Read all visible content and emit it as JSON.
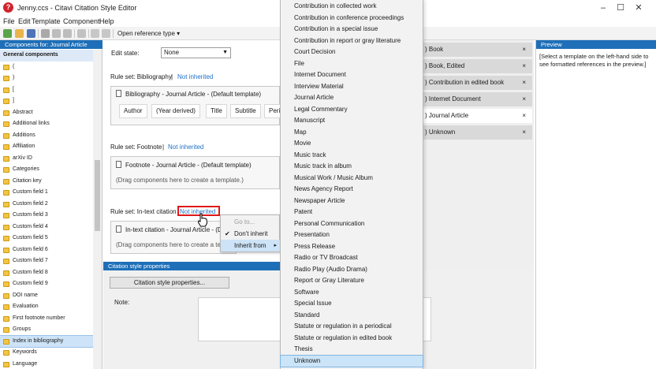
{
  "window": {
    "title": "Jenny.ccs - Citavi Citation Style Editor",
    "controls": [
      "–",
      "☐",
      "✕"
    ]
  },
  "menu": [
    "File",
    "Edit",
    "Template",
    "Component",
    "Help"
  ],
  "toolbar": {
    "open_reference_type": "Open reference type ▾"
  },
  "components_panel": {
    "header": "Components for: Journal Article",
    "group": "General components",
    "items": [
      "(",
      ")",
      "[",
      "]",
      "Abstract",
      "Additional links",
      "Additions",
      "Affiliation",
      "arXiv ID",
      "Categories",
      "Citation key",
      "Custom field 1",
      "Custom field 2",
      "Custom field 3",
      "Custom field 4",
      "Custom field 5",
      "Custom field 6",
      "Custom field 7",
      "Custom field 8",
      "Custom field 9",
      "DOI name",
      "Evaluation",
      "First footnote number",
      "Groups",
      "Index in bibliography",
      "Keywords",
      "Language"
    ],
    "selected": "Index in bibliography"
  },
  "editor": {
    "edit_state_label": "Edit state:",
    "edit_state_value": "None",
    "bibliography": {
      "label": "Rule set: Bibliography",
      "separator": "|",
      "link": "Not inherited",
      "template": "Bibliography - Journal Article - (Default template)",
      "chips": [
        "Author",
        "(Year derived)",
        "Title",
        "Subtitle",
        "Periodi"
      ]
    },
    "footnote": {
      "label": "Rule set: Footnote",
      "separator": "|",
      "link": "Not inherited",
      "template": "Footnote - Journal Article - (Default template)",
      "placeholder": "(Drag components here to create a template.)"
    },
    "intext": {
      "label": "Rule set: In-text citation",
      "link": "Not inherited",
      "template": "In-text citation - Journal Article - (D",
      "placeholder": "(Drag components here to create a tem"
    }
  },
  "context_menu": {
    "items": [
      {
        "label": "Go to...",
        "disabled": true
      },
      {
        "label": "Don't inherit",
        "checked": true
      },
      {
        "label": "Inherit from",
        "submenu": true
      }
    ],
    "check": "✔",
    "submenu_arrow": "▸"
  },
  "citation_style_properties": {
    "header": "Citation style properties",
    "button": "Citation style properties...",
    "note_label": "Note:"
  },
  "dropdown": {
    "items": [
      "Contribution in collected work",
      "Contribution in conference proceedings",
      "Contribution in a special issue",
      "Contribution in report or gray literature",
      "Court Decision",
      "File",
      "Internet Document",
      "Interview Material",
      "Journal Article",
      "Legal Commentary",
      "Manuscript",
      "Map",
      "Movie",
      "Music track",
      "Music track in album",
      "Musical Work / Music Album",
      "News Agency Report",
      "Newspaper Article",
      "Patent",
      "Personal Communication",
      "Presentation",
      "Press Release",
      "Radio or TV Broadcast",
      "Radio Play (Audio Drama)",
      "Report or Gray Literature",
      "Software",
      "Special Issue",
      "Standard",
      "Statute or regulation in a periodical",
      "Statute or regulation in edited book",
      "Thesis",
      "Unknown"
    ],
    "highlighted": "Unknown"
  },
  "tabs": {
    "items": [
      ") Book",
      ") Book, Edited",
      ") Contribution in edited book",
      ") Internet Document",
      ") Journal Article",
      ") Unknown"
    ],
    "active": ") Journal Article",
    "close": "×"
  },
  "preview": {
    "header": "Preview",
    "text": "[Select a template on the left-hand side to see formatted references in the preview.]"
  },
  "colors": {
    "accent": "#1e6fb8",
    "highlight_box": "#e01818",
    "link": "#1f6fc6"
  }
}
